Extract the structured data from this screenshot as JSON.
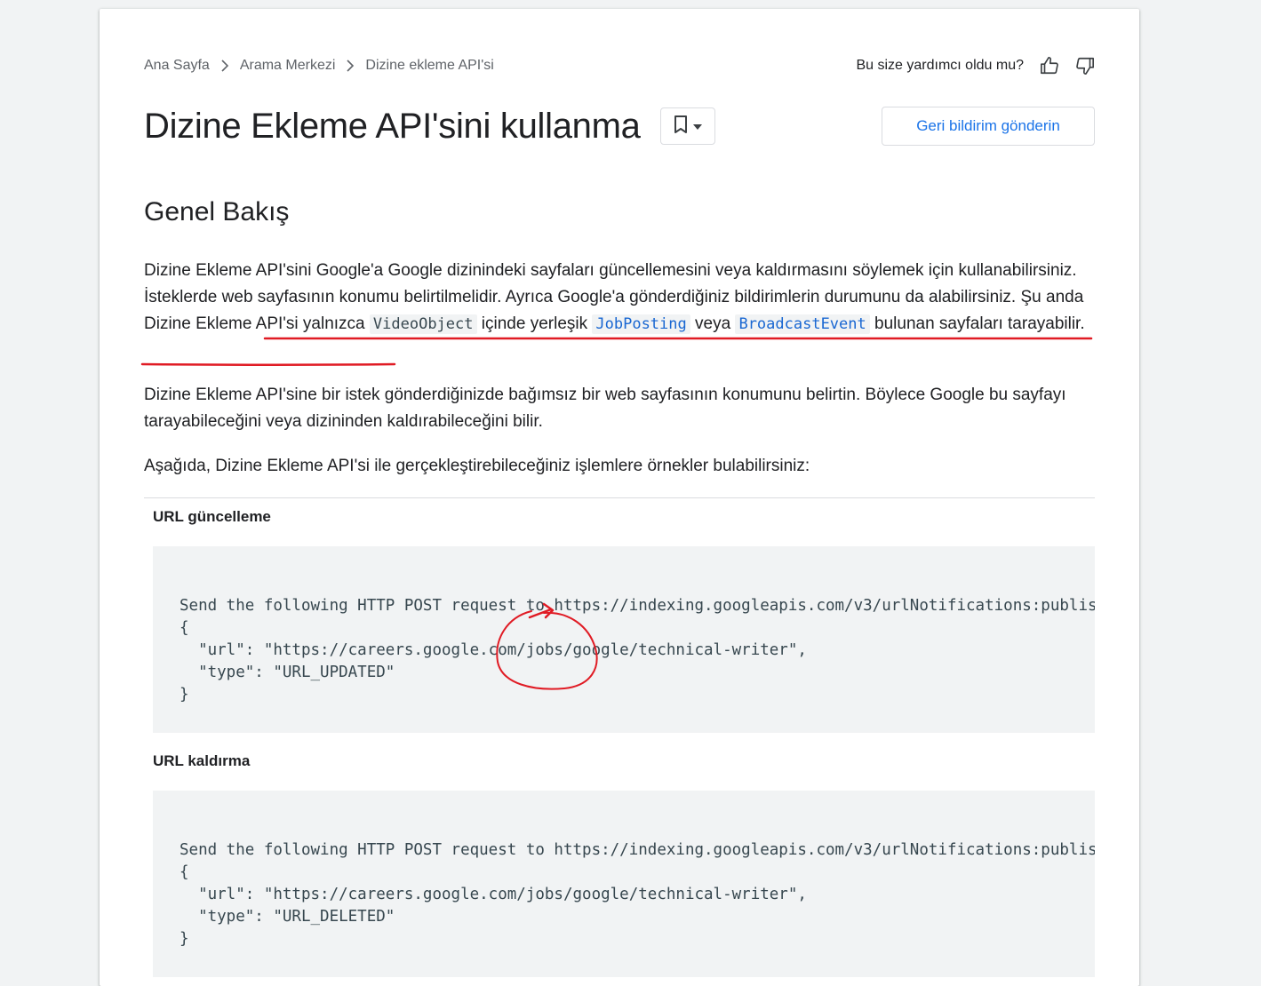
{
  "breadcrumb": {
    "items": [
      "Ana Sayfa",
      "Arama Merkezi",
      "Dizine ekleme API'si"
    ]
  },
  "helpful": {
    "question": "Bu size yardımcı oldu mu?"
  },
  "page": {
    "title": "Dizine Ekleme API'sini kullanma",
    "feedback_button": "Geri bildirim gönderin"
  },
  "overview": {
    "heading": "Genel Bakış",
    "p1_part1": "Dizine Ekleme API'sini Google'a Google dizinindeki sayfaları güncellemesini veya kaldırmasını söylemek için kullanabilirsiniz. İsteklerde web sayfasının konumu belirtilmelidir. Ayrıca Google'a gönderdiğiniz bildirimlerin durumunu da alabilirsiniz. ",
    "p1_part2": "Şu anda Dizine Ekleme API'si yalnızca ",
    "code_videoobject": "VideoObject",
    "p1_part3": " içinde yerleşik ",
    "code_jobposting": "JobPosting",
    "p1_part4": " veya ",
    "code_broadcastevent": "BroadcastEvent",
    "p1_part5": " bulunan sayfaları tarayabilir.",
    "p2": "Dizine Ekleme API'sine bir istek gönderdiğinizde bağımsız bir web sayfasının konumunu belirtin. Böylece Google bu sayfayı tarayabileceğini veya dizininden kaldırabileceğini bilir.",
    "p3": "Aşağıda, Dizine Ekleme API'si ile gerçekleştirebileceğiniz işlemlere örnekler bulabilirsiniz:"
  },
  "examples": [
    {
      "label": "URL güncelleme",
      "code": "Send the following HTTP POST request to https://indexing.googleapis.com/v3/urlNotifications:publish\n{\n  \"url\": \"https://careers.google.com/jobs/google/technical-writer\",\n  \"type\": \"URL_UPDATED\"\n}"
    },
    {
      "label": "URL kaldırma",
      "code": "Send the following HTTP POST request to https://indexing.googleapis.com/v3/urlNotifications:publish\n{\n  \"url\": \"https://careers.google.com/jobs/google/technical-writer\",\n  \"type\": \"URL_DELETED\"\n}"
    }
  ],
  "icons": {
    "breadcrumb_separator": "chevron-right-icon",
    "thumb_up": "thumb-up-icon",
    "thumb_down": "thumb-down-icon",
    "bookmark": "bookmark-icon",
    "dropdown": "arrow-drop-down-icon"
  },
  "colors": {
    "accent": "#1a73e8",
    "annotation": "#e01b24"
  }
}
